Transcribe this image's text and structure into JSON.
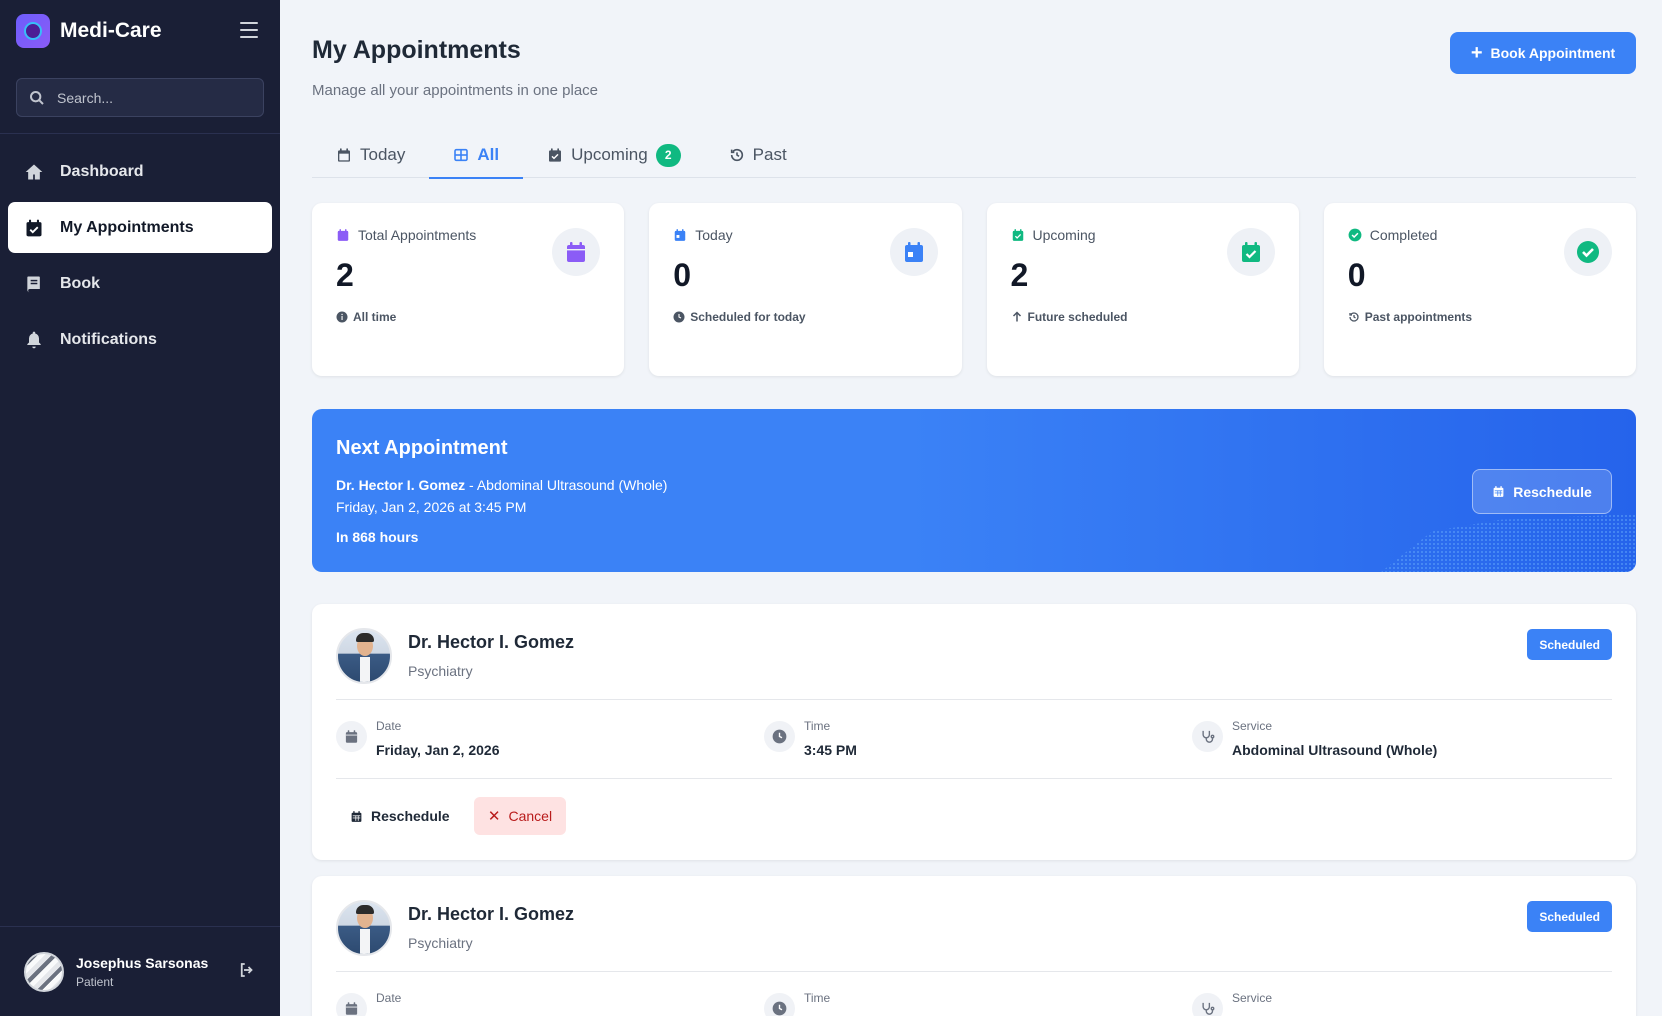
{
  "app": {
    "name": "Medi-Care"
  },
  "search": {
    "placeholder": "Search..."
  },
  "sidebar": {
    "items": [
      {
        "label": "Dashboard",
        "icon": "home-icon",
        "active": false
      },
      {
        "label": "My Appointments",
        "icon": "calendar-check-icon",
        "active": true
      },
      {
        "label": "Book",
        "icon": "book-icon",
        "active": false
      },
      {
        "label": "Notifications",
        "icon": "bell-icon",
        "active": false
      }
    ]
  },
  "user": {
    "name": "Josephus Sarsonas",
    "role": "Patient"
  },
  "header": {
    "title": "My Appointments",
    "subtitle": "Manage all your appointments in one place",
    "book_button": "Book Appointment"
  },
  "tabs": [
    {
      "label": "Today",
      "icon": "calendar-icon"
    },
    {
      "label": "All",
      "icon": "grid-icon",
      "active": true
    },
    {
      "label": "Upcoming",
      "icon": "calendar-check-icon",
      "badge": "2"
    },
    {
      "label": "Past",
      "icon": "history-icon"
    }
  ],
  "stats": [
    {
      "title": "Total Appointments",
      "value": "2",
      "footer": "All time",
      "color": "#8b5cf6"
    },
    {
      "title": "Today",
      "value": "0",
      "footer": "Scheduled for today",
      "color": "#3b82f6"
    },
    {
      "title": "Upcoming",
      "value": "2",
      "footer": "Future scheduled",
      "color": "#10b981"
    },
    {
      "title": "Completed",
      "value": "0",
      "footer": "Past appointments",
      "color": "#10b981"
    }
  ],
  "next_appointment": {
    "title": "Next Appointment",
    "doctor": "Dr. Hector I. Gomez",
    "service": " - Abdominal Ultrasound (Whole)",
    "datetime": "Friday, Jan 2, 2026 at 3:45 PM",
    "countdown": "In 868 hours",
    "reschedule_label": "Reschedule"
  },
  "appointments": [
    {
      "doctor": "Dr. Hector I. Gomez",
      "specialty": "Psychiatry",
      "status": "Scheduled",
      "date_label": "Date",
      "date": "Friday, Jan 2, 2026",
      "time_label": "Time",
      "time": "3:45 PM",
      "service_label": "Service",
      "service": "Abdominal Ultrasound (Whole)",
      "reschedule_label": "Reschedule",
      "cancel_label": "Cancel"
    },
    {
      "doctor": "Dr. Hector I. Gomez",
      "specialty": "Psychiatry",
      "status": "Scheduled",
      "date_label": "Date",
      "time_label": "Time",
      "service_label": "Service"
    }
  ],
  "colors": {
    "sidebar_bg": "#1a1f36",
    "primary": "#3b82f6",
    "success": "#10b981",
    "purple": "#8b5cf6",
    "danger_bg": "#fee2e2"
  }
}
